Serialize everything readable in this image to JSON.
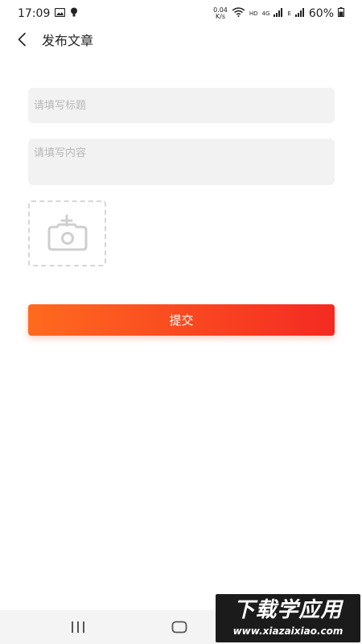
{
  "status_bar": {
    "time": "17:09",
    "net_speed_value": "0.04",
    "net_speed_unit": "K/s",
    "hd_label": "HD",
    "network_4g": "4G",
    "network_e": "E",
    "battery_percent": "60%"
  },
  "header": {
    "title": "发布文章"
  },
  "form": {
    "title_placeholder": "请填写标题",
    "content_placeholder": "请填写内容",
    "submit_label": "提交"
  },
  "watermark": {
    "line1": "下载学应用",
    "line2": "www.xiazaixiao.com"
  },
  "colors": {
    "accent_start": "#ff6a1f",
    "accent_end": "#f42a22",
    "input_bg": "#f2f2f2"
  }
}
